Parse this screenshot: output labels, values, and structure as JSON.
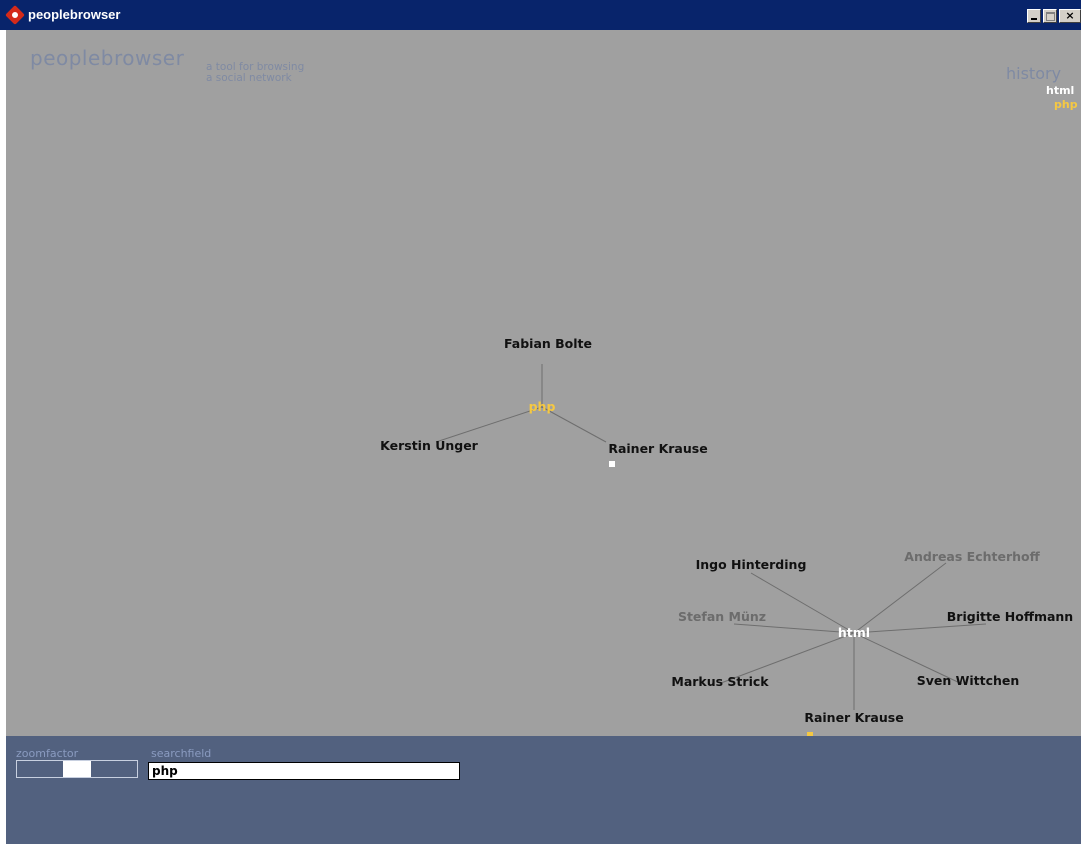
{
  "window": {
    "title": "peoplebrowser",
    "minimize_label": "",
    "maximize_label": "",
    "close_label": "×"
  },
  "brand": {
    "name": "peoplebrowser",
    "tagline_line1": "a tool for browsing",
    "tagline_line2": "a social network"
  },
  "history": {
    "title": "history",
    "items": [
      {
        "label": "html",
        "color": "#ffffff"
      },
      {
        "label": "php",
        "color": "#f5c842"
      }
    ]
  },
  "graph": {
    "colors": {
      "edge": "#6e6e6e",
      "person": "#111111",
      "person_dim": "#6c6c6c",
      "topic_active": "#f5c842",
      "topic_current": "#ffffff"
    },
    "clusters": [
      {
        "id": "php",
        "center": {
          "label": "php",
          "style": "topic_active"
        },
        "people": [
          {
            "label": "Fabian Bolte",
            "style": "person"
          },
          {
            "label": "Kerstin Unger",
            "style": "person"
          },
          {
            "label": "Rainer Krause",
            "style": "person",
            "marker": "#ffffff"
          }
        ]
      },
      {
        "id": "html",
        "center": {
          "label": "html",
          "style": "topic_current"
        },
        "people": [
          {
            "label": "Ingo Hinterding",
            "style": "person"
          },
          {
            "label": "Andreas Echterhoff",
            "style": "person_dim"
          },
          {
            "label": "Stefan Münz",
            "style": "person_dim"
          },
          {
            "label": "Brigitte Hoffmann",
            "style": "person"
          },
          {
            "label": "Markus Strick",
            "style": "person"
          },
          {
            "label": "Sven Wittchen",
            "style": "person"
          },
          {
            "label": "Rainer Krause",
            "style": "person",
            "marker": "#f5c842"
          }
        ]
      }
    ]
  },
  "controls": {
    "zoom_label": "zoomfactor",
    "zoom_level": 0.5,
    "search_label": "searchfield",
    "search_value": "php"
  }
}
